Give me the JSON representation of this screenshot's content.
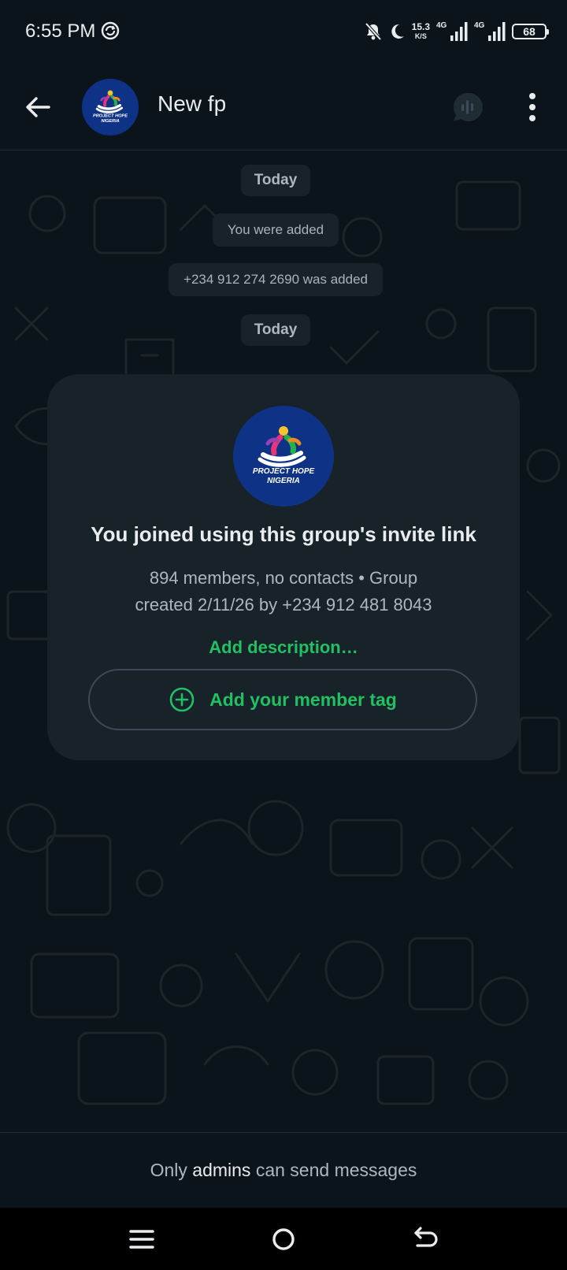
{
  "status_bar": {
    "time": "6:55 PM",
    "speed_value": "15.3",
    "speed_unit": "K/S",
    "network_1": "4G",
    "network_2": "4G",
    "battery": "68"
  },
  "header": {
    "group_name": "New fp",
    "avatar_text_line1": "PROJECT HOPE",
    "avatar_text_line2": "NIGERIA"
  },
  "messages": [
    {
      "type": "date",
      "text": "Today"
    },
    {
      "type": "system",
      "text": "You were added"
    },
    {
      "type": "system",
      "text": "+234 912 274 2690 was added"
    },
    {
      "type": "date",
      "text": "Today"
    }
  ],
  "group_card": {
    "avatar_text_line1": "PROJECT HOPE",
    "avatar_text_line2": "NIGERIA",
    "title": "You joined using this group's invite link",
    "subtitle_line1": "894 members, no contacts • Group",
    "subtitle_line2": "created 2/11/26 by +234 912 481 8043",
    "add_description": "Add description…",
    "member_tag_button": "Add your member tag"
  },
  "footer": {
    "text_before": "Only ",
    "text_emphasis": "admins",
    "text_after": " can send messages"
  },
  "colors": {
    "background": "#0b141a",
    "bubble": "#182229",
    "accent_green": "#21c063",
    "avatar_blue": "#0e3285"
  }
}
